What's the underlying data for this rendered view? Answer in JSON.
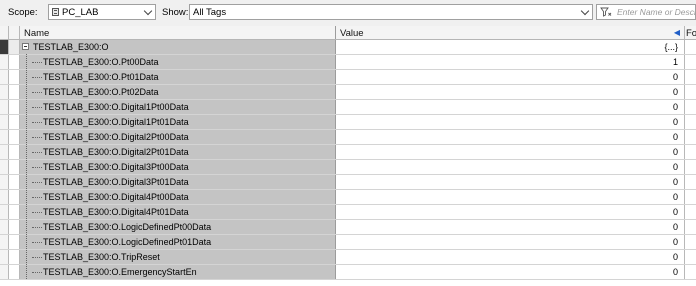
{
  "toolbar": {
    "scope_label": "Scope:",
    "scope_value": "PC_LAB",
    "show_label": "Show:",
    "show_value": "All Tags",
    "filter_placeholder": "Enter Name or Description"
  },
  "columns": {
    "name": "Name",
    "value": "Value",
    "force": "Fo"
  },
  "parent": {
    "name": "TESTLAB_E300:O",
    "value": "{...}"
  },
  "rows": [
    {
      "name": "TESTLAB_E300:O.Pt00Data",
      "value": "1"
    },
    {
      "name": "TESTLAB_E300:O.Pt01Data",
      "value": "0"
    },
    {
      "name": "TESTLAB_E300:O.Pt02Data",
      "value": "0"
    },
    {
      "name": "TESTLAB_E300:O.Digital1Pt00Data",
      "value": "0"
    },
    {
      "name": "TESTLAB_E300:O.Digital1Pt01Data",
      "value": "0"
    },
    {
      "name": "TESTLAB_E300:O.Digital2Pt00Data",
      "value": "0"
    },
    {
      "name": "TESTLAB_E300:O.Digital2Pt01Data",
      "value": "0"
    },
    {
      "name": "TESTLAB_E300:O.Digital3Pt00Data",
      "value": "0"
    },
    {
      "name": "TESTLAB_E300:O.Digital3Pt01Data",
      "value": "0"
    },
    {
      "name": "TESTLAB_E300:O.Digital4Pt00Data",
      "value": "0"
    },
    {
      "name": "TESTLAB_E300:O.Digital4Pt01Data",
      "value": "0"
    },
    {
      "name": "TESTLAB_E300:O.LogicDefinedPt00Data",
      "value": "0"
    },
    {
      "name": "TESTLAB_E300:O.LogicDefinedPt01Data",
      "value": "0"
    },
    {
      "name": "TESTLAB_E300:O.TripReset",
      "value": "0"
    },
    {
      "name": "TESTLAB_E300:O.EmergencyStartEn",
      "value": "0"
    }
  ]
}
